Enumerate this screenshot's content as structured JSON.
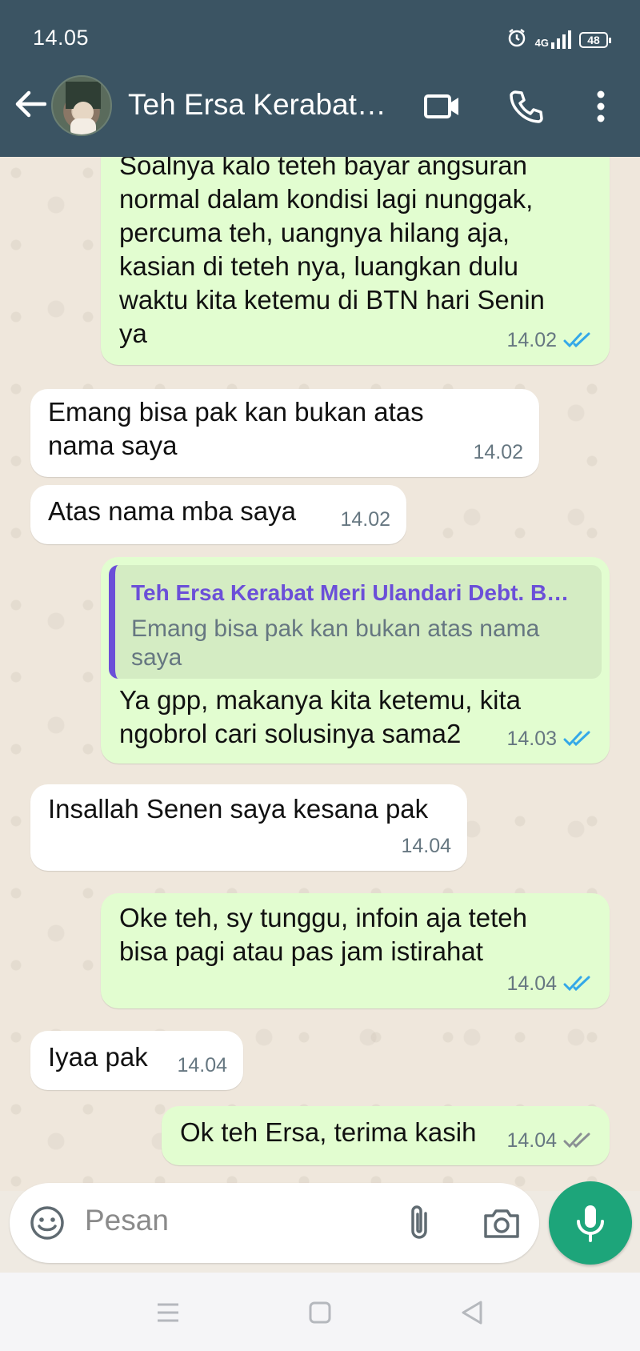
{
  "status_bar": {
    "time": "14.05",
    "network": "4G",
    "battery": "48"
  },
  "header": {
    "title": "Teh Ersa Kerabat…"
  },
  "messages": [
    {
      "direction": "out",
      "lines": [
        "Soalnya kalo teteh bayar angsuran",
        "normal dalam kondisi lagi nunggak,",
        "percuma teh, uangnya hilang aja,",
        "kasian di teteh nya, luangkan dulu",
        "waktu kita ketemu di BTN hari Senin",
        "ya"
      ],
      "time": "14.02",
      "status": "read"
    },
    {
      "direction": "in",
      "lines": [
        "Emang bisa pak kan bukan atas",
        "nama saya"
      ],
      "time": "14.02"
    },
    {
      "direction": "in",
      "lines": [
        "Atas nama mba saya"
      ],
      "time": "14.02"
    },
    {
      "direction": "out",
      "quote": {
        "name": "Teh Ersa Kerabat Meri Ulandari Debt. B…",
        "lines": [
          "Emang bisa pak kan bukan atas nama",
          "saya"
        ]
      },
      "lines": [
        "Ya gpp, makanya kita ketemu, kita",
        "ngobrol cari solusinya sama2"
      ],
      "time": "14.03",
      "status": "read"
    },
    {
      "direction": "in",
      "lines": [
        "Insallah Senen saya kesana pak"
      ],
      "time": "14.04"
    },
    {
      "direction": "out",
      "lines": [
        "Oke teh, sy tunggu, infoin aja teteh",
        "bisa pagi atau pas jam istirahat"
      ],
      "time": "14.04",
      "status": "read"
    },
    {
      "direction": "in",
      "lines": [
        "Iyaa pak"
      ],
      "time": "14.04"
    },
    {
      "direction": "out",
      "lines": [
        "Ok teh Ersa, terima kasih"
      ],
      "time": "14.04",
      "status": "delivered"
    }
  ],
  "input": {
    "placeholder": "Pesan"
  },
  "colors": {
    "header": "#3b5463",
    "outgoing": "#e2fdd0",
    "incoming": "#ffffff",
    "read_ticks": "#34a8e8",
    "delivered_ticks": "#8a8f93",
    "mic": "#1da57a",
    "quote_accent": "#6b4fd8"
  },
  "icons": [
    "back-arrow-icon",
    "video-call-icon",
    "voice-call-icon",
    "more-options-icon",
    "emoji-icon",
    "attach-icon",
    "camera-icon",
    "mic-icon",
    "alarm-icon",
    "signal-icon"
  ]
}
